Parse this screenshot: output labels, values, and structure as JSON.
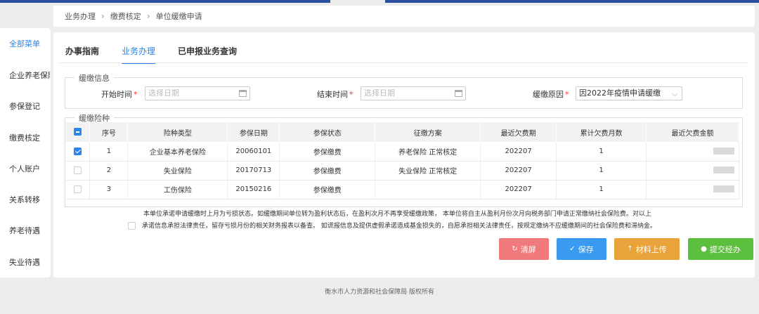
{
  "breadcrumb": [
    "业务办理",
    "缴费核定",
    "单位缓缴申请"
  ],
  "sidebar": {
    "items": [
      {
        "label": "全部菜单",
        "active": true
      },
      {
        "label": "企业养老保险",
        "active": false
      },
      {
        "label": "参保登记",
        "active": false
      },
      {
        "label": "缴费核定",
        "active": false
      },
      {
        "label": "个人账户",
        "active": false
      },
      {
        "label": "关系转移",
        "active": false
      },
      {
        "label": "养老待遇",
        "active": false
      },
      {
        "label": "失业待遇",
        "active": false
      }
    ]
  },
  "tabs": [
    "办事指南",
    "业务办理",
    "已申报业务查询"
  ],
  "deferral": {
    "legend": "缓缴信息",
    "start_label": "开始时间",
    "start_placeholder": "选择日期",
    "end_label": "结束时间",
    "end_placeholder": "选择日期",
    "reason_label": "缓缴原因",
    "reason_value": "因2022年疫情申请缓缴"
  },
  "insurance": {
    "legend": "缓缴险种",
    "headers": [
      "序号",
      "险种类型",
      "参保日期",
      "参保状态",
      "征缴方案",
      "最近欠费期",
      "累计欠费月数",
      "最近欠费金额"
    ],
    "rows": [
      {
        "checked": true,
        "no": "1",
        "type": "企业基本养老保险",
        "date": "20060101",
        "status": "参保缴费",
        "plan": "养老保险 正常核定",
        "period": "202207",
        "months": "1"
      },
      {
        "checked": false,
        "no": "2",
        "type": "失业保险",
        "date": "20170713",
        "status": "参保缴费",
        "plan": "失业保险 正常核定",
        "period": "202207",
        "months": "1"
      },
      {
        "checked": false,
        "no": "3",
        "type": "工伤保险",
        "date": "20150216",
        "status": "参保缴费",
        "plan": "",
        "period": "202207",
        "months": "1"
      }
    ]
  },
  "notice": {
    "line1": "本单位承诺申请缓缴时上月为亏损状态。如缓缴期间单位转为盈利状态后，在盈利次月不再享受缓缴政策， 本单位将自主从盈利月份次月向税务部门申请正常缴纳社会保险费。对以上",
    "line2": "承诺信息承担法律责任，留存亏损月份的相关财务报表以备查。 如谎报信息及提供虚假承诺造成基金损失的，自愿承担相关法律责任，按规定缴纳不应缓缴期间的社会保险费和滞纳金。"
  },
  "buttons": {
    "clear": "清屏",
    "save": "保存",
    "upload": "材料上传",
    "submit": "提交经办"
  },
  "colors": {
    "accent": "#2b86ea",
    "clear": "#f07a7b",
    "save": "#3a9af0",
    "upload": "#e8a43a",
    "submit": "#5cbf3e"
  },
  "footer": "衡水市人力资源和社会保障局   版权所有"
}
